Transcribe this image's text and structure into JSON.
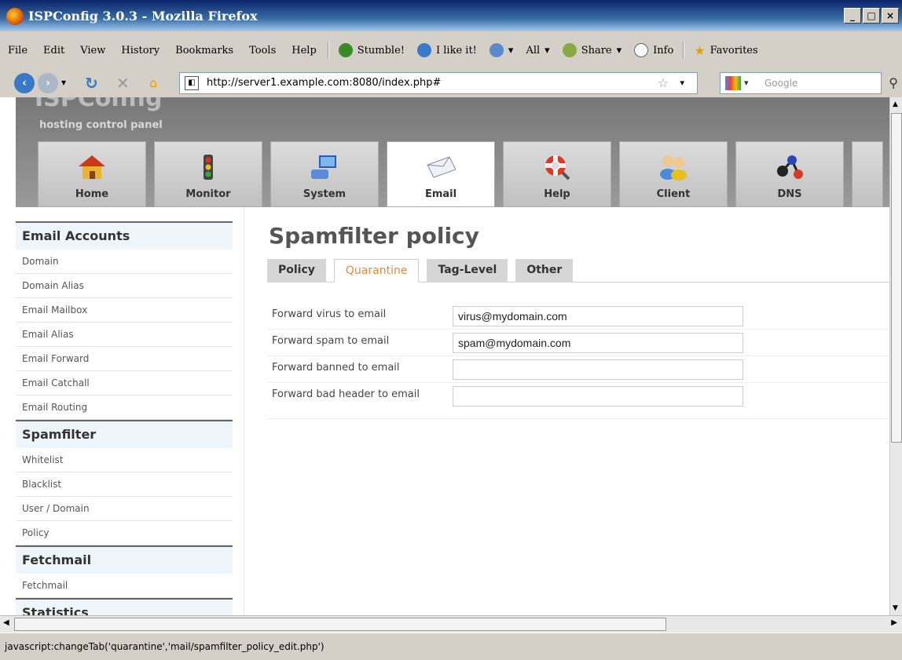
{
  "window": {
    "title": "ISPConfig 3.0.3 - Mozilla Firefox",
    "min": "_",
    "max": "□",
    "close": "×"
  },
  "menu": [
    "File",
    "Edit",
    "View",
    "History",
    "Bookmarks",
    "Tools",
    "Help"
  ],
  "toolbar": {
    "stumble": "Stumble!",
    "ilike": "I like it!",
    "all": "All",
    "share": "Share",
    "info": "Info",
    "favorites": "Favorites"
  },
  "nav": {
    "url": "http://server1.example.com:8080/index.php#",
    "search_placeholder": "Google"
  },
  "header": {
    "logo": "ISPConfig",
    "subtitle": "hosting control panel"
  },
  "tabs": [
    {
      "label": "Home",
      "icon": "home-icon"
    },
    {
      "label": "Monitor",
      "icon": "traffic-light-icon"
    },
    {
      "label": "System",
      "icon": "computer-icon"
    },
    {
      "label": "Email",
      "icon": "envelope-icon"
    },
    {
      "label": "Help",
      "icon": "lifebuoy-icon"
    },
    {
      "label": "Client",
      "icon": "users-icon"
    },
    {
      "label": "DNS",
      "icon": "network-icon"
    }
  ],
  "sidebar": {
    "email_accounts": "Email Accounts",
    "email_items": [
      "Domain",
      "Domain Alias",
      "Email Mailbox",
      "Email Alias",
      "Email Forward",
      "Email Catchall",
      "Email Routing"
    ],
    "spamfilter": "Spamfilter",
    "spam_items": [
      "Whitelist",
      "Blacklist",
      "User / Domain",
      "Policy"
    ],
    "fetchmail": "Fetchmail",
    "fetch_items": [
      "Fetchmail"
    ],
    "statistics": "Statistics"
  },
  "main": {
    "title": "Spamfilter policy",
    "tabs": [
      "Policy",
      "Quarantine",
      "Tag-Level",
      "Other"
    ],
    "fields": [
      {
        "label": "Forward virus to email",
        "value": "virus@mydomain.com"
      },
      {
        "label": "Forward spam to email",
        "value": "spam@mydomain.com"
      },
      {
        "label": "Forward banned to email",
        "value": ""
      },
      {
        "label": "Forward bad header to email",
        "value": ""
      }
    ]
  },
  "status": "javascript:changeTab('quarantine','mail/spamfilter_policy_edit.php')"
}
